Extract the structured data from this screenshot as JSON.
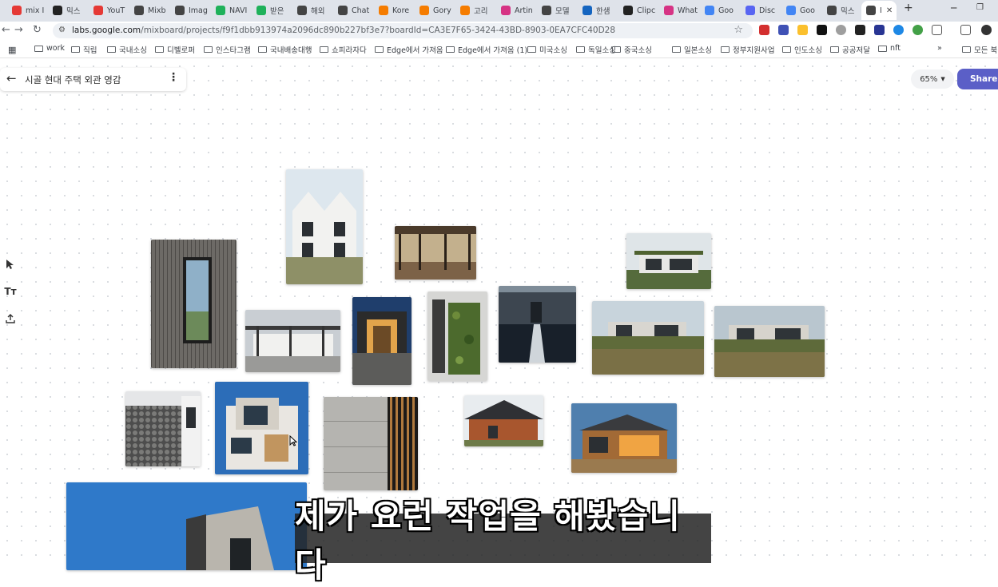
{
  "browser": {
    "tabs": [
      {
        "label": "mix I",
        "color": "#e53935"
      },
      {
        "label": "믹스",
        "color": "#222"
      },
      {
        "label": "YouT",
        "color": "#e53935"
      },
      {
        "label": "Mixb",
        "color": "#444"
      },
      {
        "label": "Imag",
        "color": "#444"
      },
      {
        "label": "NAVI",
        "color": "#1fb15a"
      },
      {
        "label": "받은",
        "color": "#1fb15a"
      },
      {
        "label": "해외",
        "color": "#444"
      },
      {
        "label": "Chat",
        "color": "#444"
      },
      {
        "label": "Kore",
        "color": "#f57c00"
      },
      {
        "label": "Gory",
        "color": "#f57c00"
      },
      {
        "label": "고리",
        "color": "#f57c00"
      },
      {
        "label": "Artin",
        "color": "#d63384"
      },
      {
        "label": "모델",
        "color": "#444"
      },
      {
        "label": "한샘",
        "color": "#1565c0"
      },
      {
        "label": "Clipc",
        "color": "#222"
      },
      {
        "label": "What",
        "color": "#d63384"
      },
      {
        "label": "Goo",
        "color": "#4285f4"
      },
      {
        "label": "Disc",
        "color": "#5865f2"
      },
      {
        "label": "Goo",
        "color": "#4285f4"
      },
      {
        "label": "믹스",
        "color": "#444"
      },
      {
        "label": "I",
        "color": "#444",
        "active": true
      }
    ],
    "address": "labs.google.com",
    "address_path": "/mixboard/projects/f9f1dbb913974a2096dc890b227bf3e7?boardId=CA3E7F65-3424-43BD-8903-0EA7CFC40D28",
    "bookmarks": [
      "work",
      "직립",
      "국내소싱",
      "디벨로퍼",
      "인스타그램",
      "국내배송대행",
      "쇼피라자다",
      "Edge에서 가져옴",
      "Edge에서 가져옴 (1)",
      "미국소싱",
      "독일소싱",
      "중국소싱",
      "일본소싱",
      "정부지원사업",
      "인도소싱",
      "공공저달",
      "nft"
    ],
    "bookmarks_more": "»",
    "all_bookmarks": "모든 북"
  },
  "board": {
    "title": "시골 현대 주택 외관 영감",
    "zoom": "65%",
    "share_label": "Share"
  },
  "subtitle": "제가 요런 작업을 해봤습니다",
  "colors": {
    "accent": "#5b5fc7",
    "tabbar": "#dfe3ea"
  }
}
